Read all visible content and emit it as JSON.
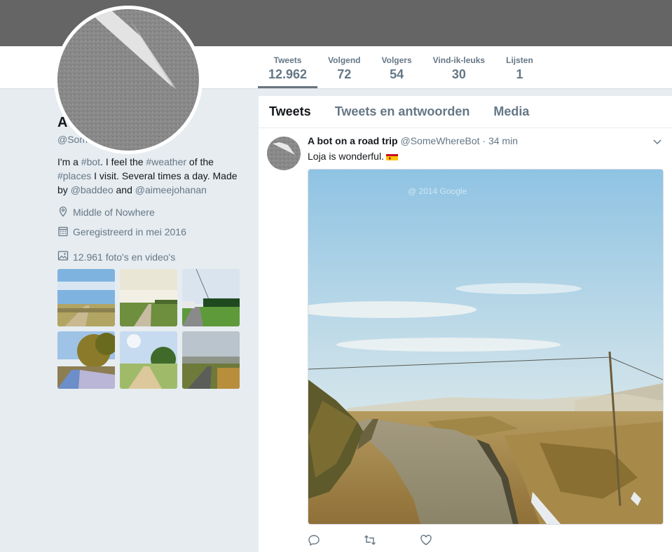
{
  "profile": {
    "name": "A bot on a road trip",
    "handle": "@SomeWhereBot",
    "bio": {
      "p1": "I'm a ",
      "tag1": "#bot",
      "p2": ". I feel the ",
      "tag2": "#weather",
      "p3": " of the ",
      "tag3": "#places",
      "p4": " I visit. Several times a day. Made by ",
      "mention1": "@baddeo",
      "p5": " and ",
      "mention2": "@aimeejohanan"
    },
    "location": "Middle of Nowhere",
    "joined": "Geregistreerd in mei 2016",
    "photos_label": "12.961 foto's en video's"
  },
  "stats": [
    {
      "label": "Tweets",
      "value": "12.962"
    },
    {
      "label": "Volgend",
      "value": "72"
    },
    {
      "label": "Volgers",
      "value": "54"
    },
    {
      "label": "Vind-ik-leuks",
      "value": "30"
    },
    {
      "label": "Lijsten",
      "value": "1"
    }
  ],
  "tabs": [
    "Tweets",
    "Tweets en antwoorden",
    "Media"
  ],
  "tweet": {
    "name": "A bot on a road trip",
    "handle": "@SomeWhereBot",
    "time": "· 34 min",
    "text": "Loja is wonderful.",
    "flag": "spain-flag",
    "watermark": "@ 2014 Google"
  },
  "icons": {
    "location": "map-pin-icon",
    "calendar": "calendar-icon",
    "photos": "image-icon",
    "reply": "reply-icon",
    "retweet": "retweet-icon",
    "like": "heart-icon",
    "caret": "chevron-down-icon"
  },
  "colors": {
    "banner": "#656565",
    "page_bg": "#e6ecf0",
    "muted": "#657786",
    "text": "#14171a"
  }
}
